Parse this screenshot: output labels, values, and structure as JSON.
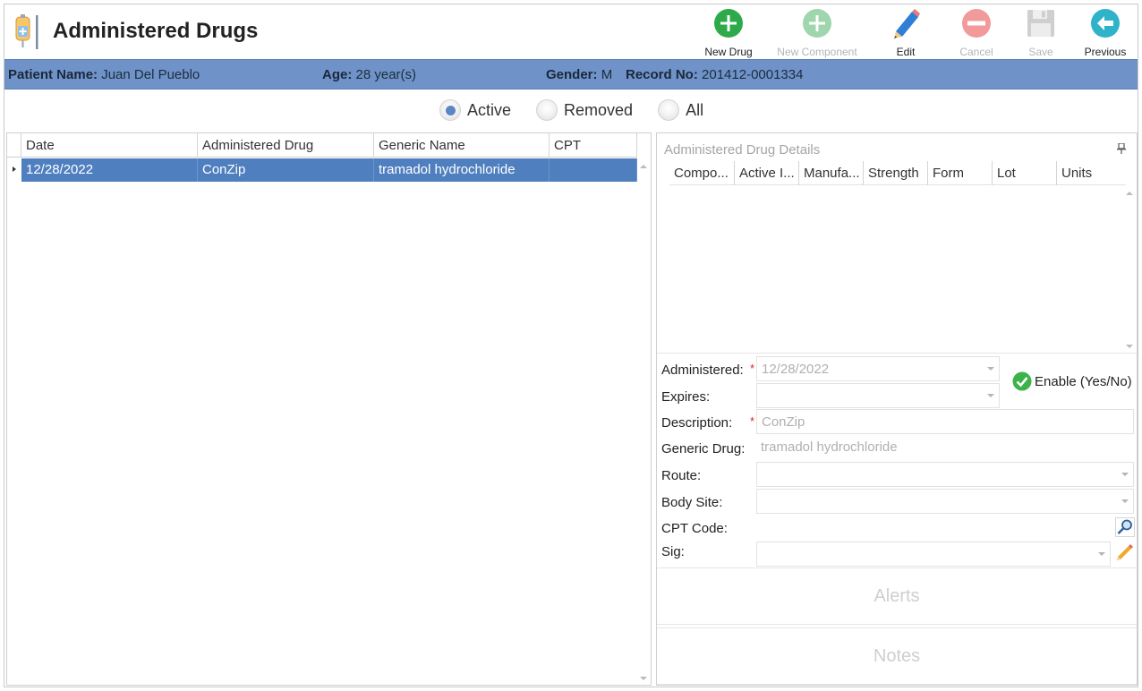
{
  "header": {
    "title": "Administered Drugs",
    "logo_icon": "iv-drug-bag-icon"
  },
  "toolbar": [
    {
      "label": "New Drug",
      "icon": "plus-circle-icon",
      "color": "#2eaa4a",
      "enabled": true
    },
    {
      "label": "New Component",
      "icon": "plus-circle-icon",
      "color": "#9fd6ad",
      "enabled": false
    },
    {
      "label": "Edit",
      "icon": "pencil-icon",
      "color": "#2f7fd6",
      "enabled": true
    },
    {
      "label": "Cancel",
      "icon": "minus-circle-icon",
      "color": "#f29a9a",
      "enabled": false
    },
    {
      "label": "Save",
      "icon": "floppy-disk-icon",
      "color": "#cfcfcf",
      "enabled": false
    },
    {
      "label": "Previous",
      "icon": "arrow-left-circle-icon",
      "color": "#2eb3c9",
      "enabled": true
    }
  ],
  "patient": {
    "name_label": "Patient Name:",
    "name_value": "Juan Del Pueblo",
    "age_label": "Age:",
    "age_value": "28 year(s)",
    "gender_label": "Gender:",
    "gender_value": "M",
    "record_label": "Record No:",
    "record_value": "201412-0001334"
  },
  "filters": [
    {
      "label": "Active",
      "checked": true
    },
    {
      "label": "Removed",
      "checked": false
    },
    {
      "label": "All",
      "checked": false
    }
  ],
  "grid": {
    "columns": [
      "Date",
      "Administered Drug",
      "Generic Name",
      "CPT"
    ],
    "rows": [
      {
        "date": "12/28/2022",
        "drug": "ConZip",
        "generic": "tramadol hydrochloride",
        "cpt": "",
        "selected": true
      }
    ]
  },
  "details": {
    "title": "Administered Drug Details",
    "component_columns": [
      "Compo...",
      "Active I...",
      "Manufa...",
      "Strength",
      "Form",
      "Lot",
      "Units"
    ],
    "administered_label": "Administered:",
    "administered_value": "12/28/2022",
    "expires_label": "Expires:",
    "expires_value": "",
    "enable_label": "Enable (Yes/No)",
    "description_label": "Description:",
    "description_value": "ConZip",
    "generic_label": "Generic Drug:",
    "generic_value": "tramadol hydrochloride",
    "route_label": "Route:",
    "route_value": "",
    "body_site_label": "Body Site:",
    "body_site_value": "",
    "cpt_label": "CPT Code:",
    "sig_label": "Sig:",
    "sig_value": "",
    "alerts_label": "Alerts",
    "notes_label": "Notes"
  },
  "colors": {
    "patient_bar": "#6f93c8",
    "selected_row": "#4f7fbf",
    "required_star": "#d22222"
  }
}
